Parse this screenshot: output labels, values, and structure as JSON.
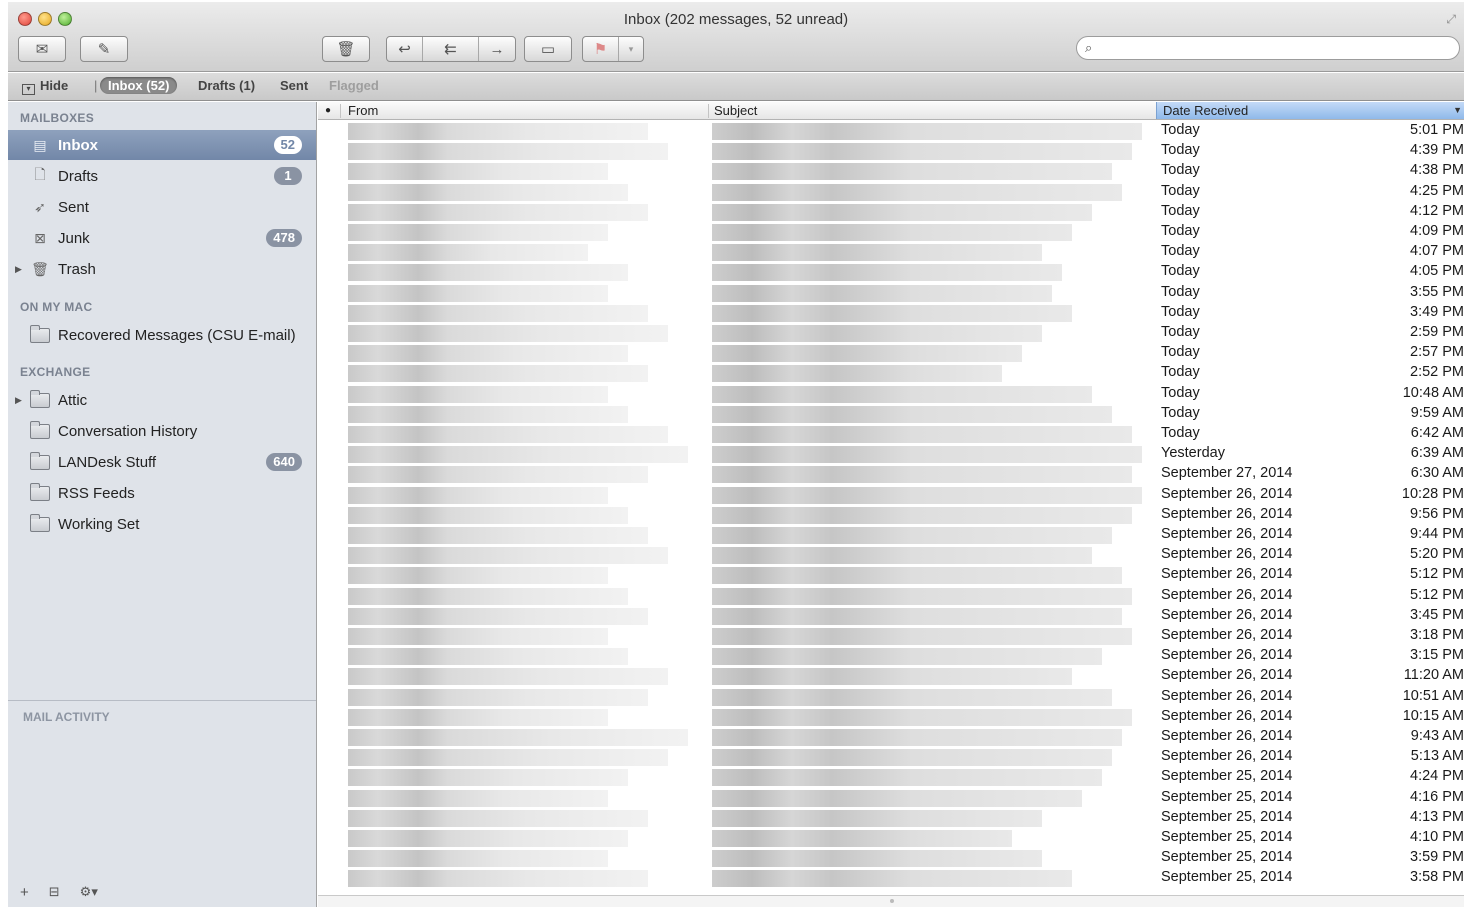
{
  "window": {
    "title": "Inbox (202 messages, 52 unread)"
  },
  "toolbar": {
    "get_mail_icon": "envelope-icon",
    "compose_icon": "compose-icon",
    "delete_icon": "trash-icon",
    "reply_icon": "reply-icon",
    "reply_all_icon": "reply-all-icon",
    "forward_icon": "forward-icon",
    "archive_icon": "archive-icon",
    "flag_icon": "flag-icon",
    "search_placeholder": ""
  },
  "favorites": {
    "hide": "Hide",
    "inbox": "Inbox (52)",
    "drafts": "Drafts (1)",
    "sent": "Sent",
    "flagged": "Flagged"
  },
  "sidebar": {
    "mailboxes_heading": "MAILBOXES",
    "mailboxes": [
      {
        "label": "Inbox",
        "badge": "52",
        "icon": "inbox-icon",
        "selected": true
      },
      {
        "label": "Drafts",
        "badge": "1",
        "icon": "drafts-icon"
      },
      {
        "label": "Sent",
        "badge": "",
        "icon": "sent-icon"
      },
      {
        "label": "Junk",
        "badge": "478",
        "icon": "junk-icon"
      },
      {
        "label": "Trash",
        "badge": "",
        "icon": "trash-icon"
      }
    ],
    "on_my_mac_heading": "ON MY MAC",
    "on_my_mac": [
      {
        "label": "Recovered Messages (CSU E-mail)",
        "icon": "folder-icon"
      }
    ],
    "exchange_heading": "EXCHANGE",
    "exchange": [
      {
        "label": "Attic",
        "badge": "",
        "icon": "folder-icon"
      },
      {
        "label": "Conversation History",
        "badge": "",
        "icon": "folder-icon"
      },
      {
        "label": "LANDesk Stuff",
        "badge": "640",
        "icon": "folder-icon"
      },
      {
        "label": "RSS Feeds",
        "badge": "",
        "icon": "folder-icon"
      },
      {
        "label": "Working Set",
        "badge": "",
        "icon": "folder-icon"
      }
    ],
    "activity_heading": "MAIL ACTIVITY",
    "add_label": "+",
    "gear_label": "⚙▾"
  },
  "message_list": {
    "columns": {
      "unread": "●",
      "from": "From",
      "subject": "Subject",
      "date": "Date Received"
    },
    "sort_indicator": "▼",
    "rows": [
      {
        "date": "Today",
        "time": "5:01 PM"
      },
      {
        "date": "Today",
        "time": "4:39 PM"
      },
      {
        "date": "Today",
        "time": "4:38 PM"
      },
      {
        "date": "Today",
        "time": "4:25 PM"
      },
      {
        "date": "Today",
        "time": "4:12 PM"
      },
      {
        "date": "Today",
        "time": "4:09 PM"
      },
      {
        "date": "Today",
        "time": "4:07 PM"
      },
      {
        "date": "Today",
        "time": "4:05 PM"
      },
      {
        "date": "Today",
        "time": "3:55 PM"
      },
      {
        "date": "Today",
        "time": "3:49 PM"
      },
      {
        "date": "Today",
        "time": "2:59 PM"
      },
      {
        "date": "Today",
        "time": "2:57 PM"
      },
      {
        "date": "Today",
        "time": "2:52 PM"
      },
      {
        "date": "Today",
        "time": "10:48 AM"
      },
      {
        "date": "Today",
        "time": "9:59 AM"
      },
      {
        "date": "Today",
        "time": "6:42 AM"
      },
      {
        "date": "Yesterday",
        "time": "6:39 AM"
      },
      {
        "date": "September 27, 2014",
        "time": "6:30 AM"
      },
      {
        "date": "September 26, 2014",
        "time": "10:28 PM"
      },
      {
        "date": "September 26, 2014",
        "time": "9:56 PM"
      },
      {
        "date": "September 26, 2014",
        "time": "9:44 PM"
      },
      {
        "date": "September 26, 2014",
        "time": "5:20 PM"
      },
      {
        "date": "September 26, 2014",
        "time": "5:12 PM"
      },
      {
        "date": "September 26, 2014",
        "time": "5:12 PM"
      },
      {
        "date": "September 26, 2014",
        "time": "3:45 PM"
      },
      {
        "date": "September 26, 2014",
        "time": "3:18 PM"
      },
      {
        "date": "September 26, 2014",
        "time": "3:15 PM"
      },
      {
        "date": "September 26, 2014",
        "time": "11:20 AM"
      },
      {
        "date": "September 26, 2014",
        "time": "10:51 AM"
      },
      {
        "date": "September 26, 2014",
        "time": "10:15 AM"
      },
      {
        "date": "September 26, 2014",
        "time": "9:43 AM"
      },
      {
        "date": "September 26, 2014",
        "time": "5:13 AM"
      },
      {
        "date": "September 25, 2014",
        "time": "4:24 PM"
      },
      {
        "date": "September 25, 2014",
        "time": "4:16 PM"
      },
      {
        "date": "September 25, 2014",
        "time": "4:13 PM"
      },
      {
        "date": "September 25, 2014",
        "time": "4:10 PM"
      },
      {
        "date": "September 25, 2014",
        "time": "3:59 PM"
      },
      {
        "date": "September 25, 2014",
        "time": "3:58 PM"
      }
    ]
  },
  "colors": {
    "sidebar_bg": "#dfe3e9",
    "selection": "#7287a8",
    "badge": "#8a93a3",
    "sort_header": "#8fb9ea",
    "blur": "#cccccc"
  }
}
